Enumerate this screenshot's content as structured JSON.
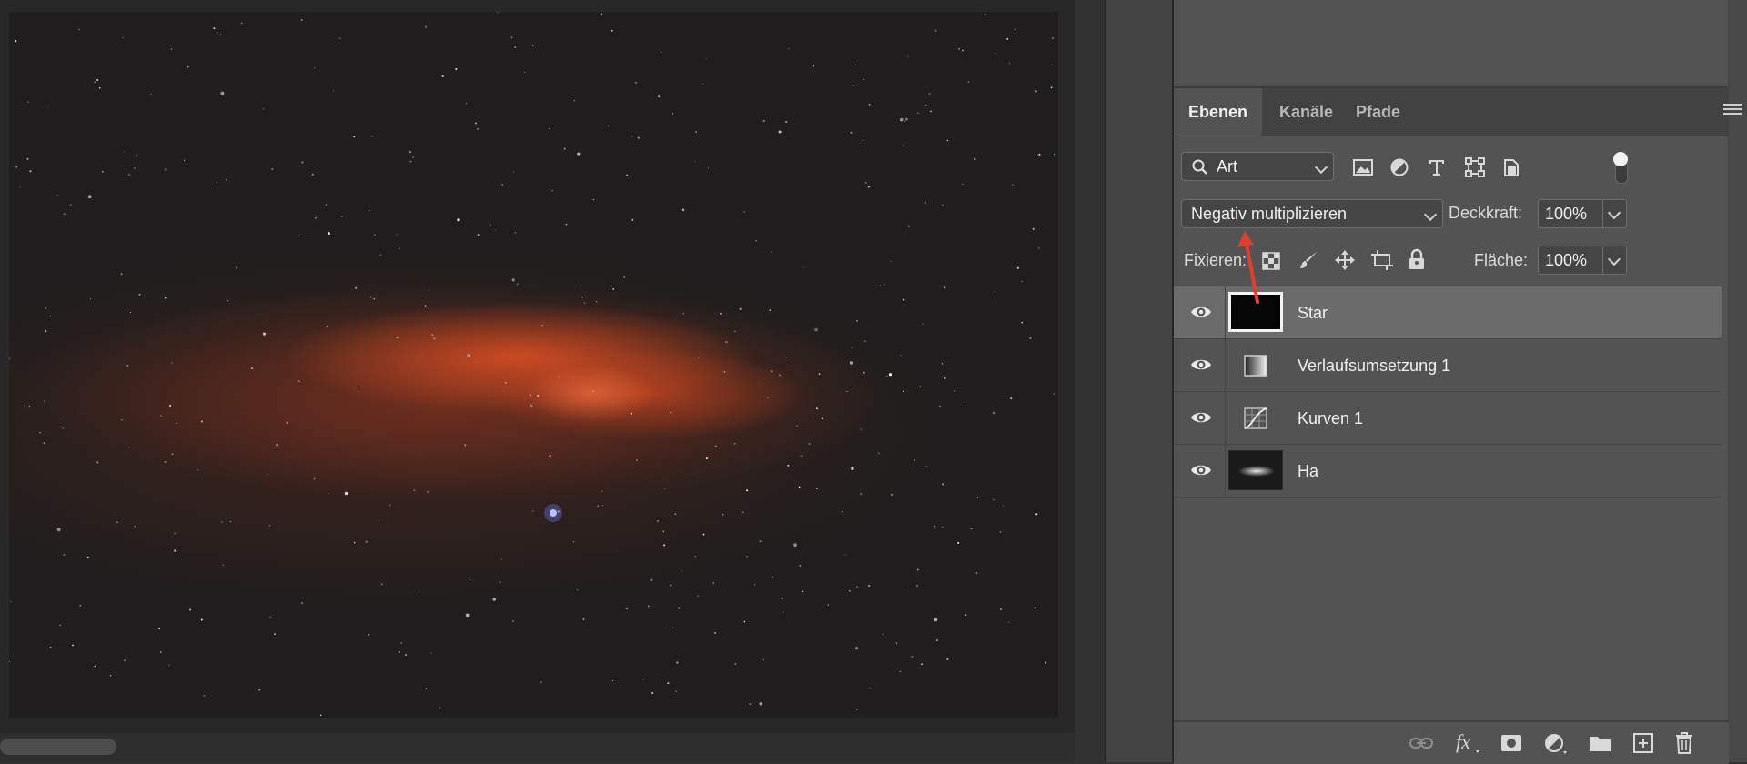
{
  "panel": {
    "tabs": [
      {
        "label": "Ebenen",
        "active": true
      },
      {
        "label": "Kanäle",
        "active": false
      },
      {
        "label": "Pfade",
        "active": false
      }
    ],
    "filter": {
      "label": "Art",
      "icon": "search-icon"
    },
    "blend_mode": "Negativ multiplizieren",
    "opacity_label": "Deckkraft:",
    "opacity_value": "100%",
    "lock_label": "Fixieren:",
    "fill_label": "Fläche:",
    "fill_value": "100%",
    "layers": [
      {
        "name": "Star",
        "type": "pixel",
        "selected": true,
        "visible": true
      },
      {
        "name": "Verlaufsumsetzung 1",
        "type": "gradient-map-adjustment",
        "selected": false,
        "visible": true
      },
      {
        "name": "Kurven 1",
        "type": "curves-adjustment",
        "selected": false,
        "visible": true
      },
      {
        "name": "Ha",
        "type": "pixel",
        "selected": false,
        "visible": true
      }
    ],
    "bottom_icons": [
      "link-icon",
      "fx-icon",
      "mask-icon",
      "adjustment-icon",
      "folder-icon",
      "new-layer-icon",
      "trash-icon"
    ]
  },
  "colors": {
    "panel_bg": "#535353",
    "selected_row": "#6b6b6b",
    "annotation_arrow": "#e0402a",
    "nebula": "#d9502a"
  }
}
